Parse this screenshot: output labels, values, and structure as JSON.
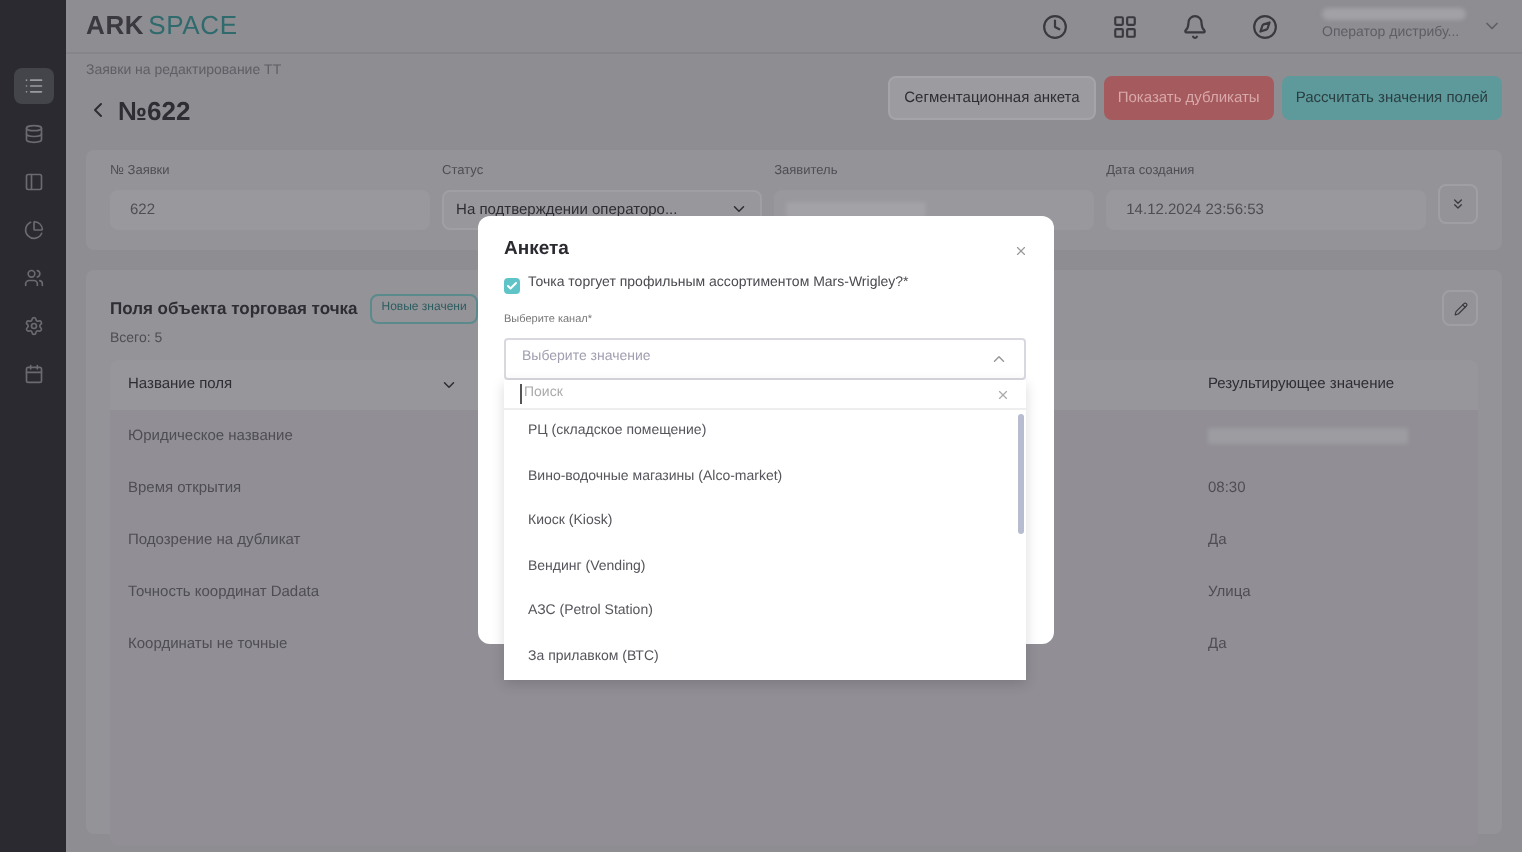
{
  "header": {
    "logo_left": "ARK",
    "logo_right": "SPACE",
    "user_role": "Оператор дистрибу..."
  },
  "sidebar": {
    "items": [
      {
        "selected": true
      },
      {
        "selected": false
      },
      {
        "selected": false
      },
      {
        "selected": false
      },
      {
        "selected": false
      },
      {
        "selected": false
      },
      {
        "selected": false
      }
    ]
  },
  "breadcrumb": "Заявки на редактирование ТТ",
  "page_title": "№622",
  "actions": [
    {
      "label": "Сегментационная анкета",
      "kind": "plain"
    },
    {
      "label": "Показать дубликаты",
      "kind": "danger"
    },
    {
      "label": "Рассчитать значения полей",
      "kind": "primary"
    }
  ],
  "fields": [
    {
      "label": "№ Заявки",
      "value": "622",
      "kind": "text"
    },
    {
      "label": "Статус",
      "value": "На подтверждении операторо...",
      "kind": "select"
    },
    {
      "label": "Заявитель",
      "kind": "redacted"
    },
    {
      "label": "Дата создания",
      "value": "14.12.2024 23:56:53",
      "kind": "text"
    }
  ],
  "section": {
    "title": "Поля объекта торговая точка",
    "tag": "Новые значени",
    "total": "Всего: 5"
  },
  "table": {
    "columns": [
      "Название поля",
      "Результирующее значение"
    ],
    "rows": [
      {
        "name": "Юридическое название",
        "result": null
      },
      {
        "name": "Время открытия",
        "result": "08:30"
      },
      {
        "name": "Подозрение на дубликат",
        "result": "Да"
      },
      {
        "name": "Точность координат Dadata",
        "result": "Улица"
      },
      {
        "name": "Координаты не точные",
        "result": "Да"
      }
    ]
  },
  "modal": {
    "title": "Анкета",
    "checkbox": {
      "label": "Точка торгует профильным ассортиментом Mars-Wrigley?*",
      "checked": true
    },
    "select_label": "Выберите канал*",
    "select_placeholder": "Выберите значение",
    "expanded": true,
    "search_placeholder": "Поиск",
    "options": [
      "РЦ (складское помещение)",
      "Вино-водочные магазины (Alco-market)",
      "Киоск (Kiosk)",
      "Вендинг (Vending)",
      "АЗС (Petrol Station)",
      "За прилавком (ВТС)"
    ]
  }
}
